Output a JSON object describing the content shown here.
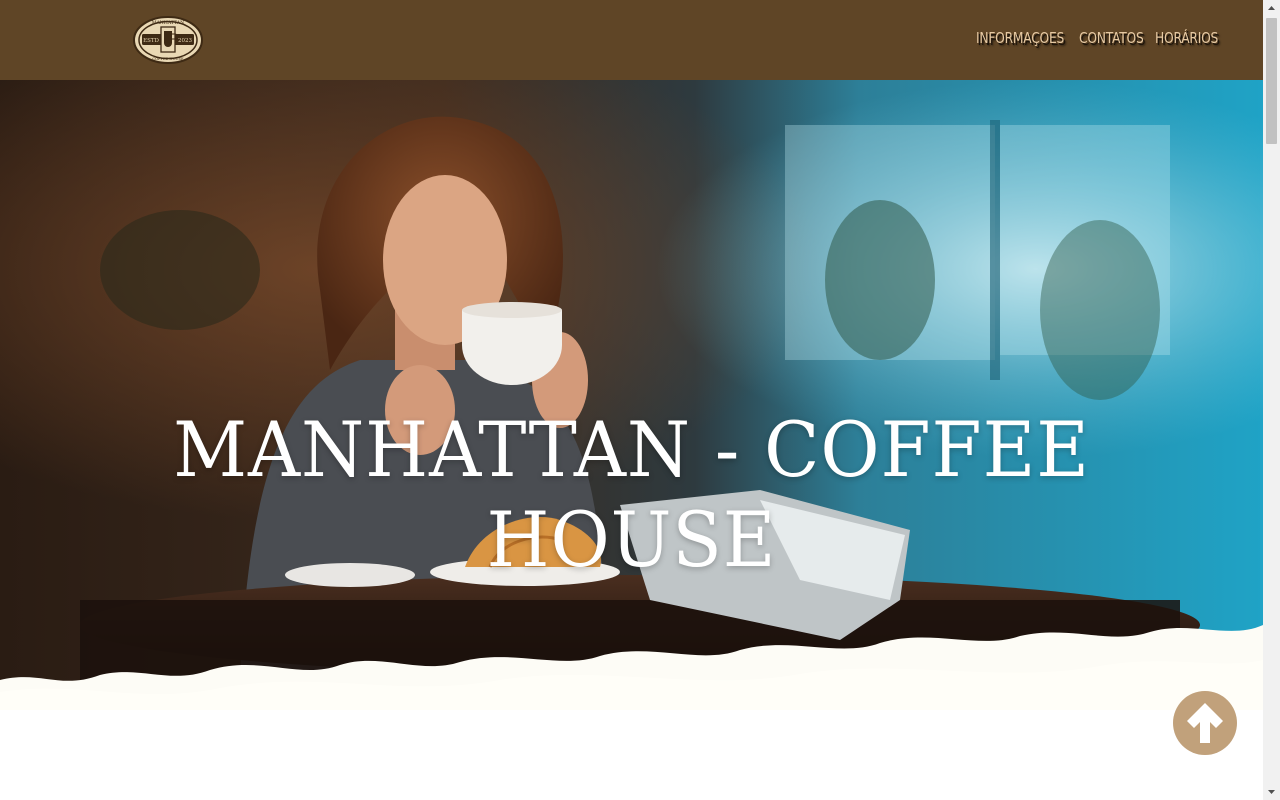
{
  "header": {
    "logo": {
      "name": "manhattan-coffee-logo",
      "text_top": "MANHATTAN",
      "text_left": "ESTD",
      "text_right": "2023",
      "text_bottom": "COFFEE HOUSE"
    },
    "nav": [
      {
        "label": "INFORMAÇOES"
      },
      {
        "label": "CONTATOS"
      },
      {
        "label": "HORÁRIOS"
      }
    ]
  },
  "hero": {
    "title": "MANHATTAN - COFFEE HOUSE"
  },
  "back_to_top": {
    "icon": "arrow-up-icon"
  },
  "colors": {
    "header_bg": "#5f4526",
    "nav_text": "#e6c9a3",
    "accent": "#c1a17b",
    "hero_text": "#ffffff"
  }
}
